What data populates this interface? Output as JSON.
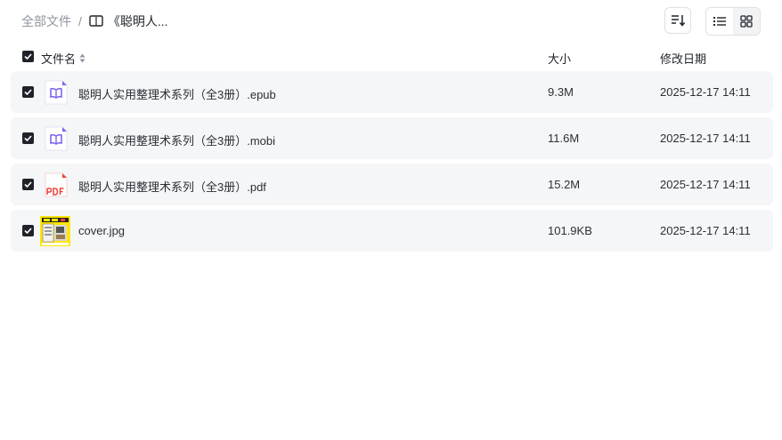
{
  "breadcrumb": {
    "root": "全部文件",
    "separator": "/",
    "current": "《聪明人..."
  },
  "toolbar": {
    "sort_icon": "sort-icon",
    "list_view_icon": "list-view-icon",
    "grid_view_icon": "grid-view-icon"
  },
  "table": {
    "columns": {
      "name": "文件名",
      "size": "大小",
      "date": "修改日期"
    },
    "rows": [
      {
        "name": "聪明人实用整理术系列（全3册）.epub",
        "size": "9.3M",
        "date": "2025-12-17 14:11",
        "type": "epub"
      },
      {
        "name": "聪明人实用整理术系列（全3册）.mobi",
        "size": "11.6M",
        "date": "2025-12-17 14:11",
        "type": "mobi"
      },
      {
        "name": "聪明人实用整理术系列（全3册）.pdf",
        "size": "15.2M",
        "date": "2025-12-17 14:11",
        "type": "pdf"
      },
      {
        "name": "cover.jpg",
        "size": "101.9KB",
        "date": "2025-12-17 14:11",
        "type": "image"
      }
    ]
  },
  "colors": {
    "ebook_icon": "#7b68ee",
    "pdf_icon": "#e8453c",
    "row_bg": "#f5f6f7",
    "checkbox": "#1f2329"
  }
}
